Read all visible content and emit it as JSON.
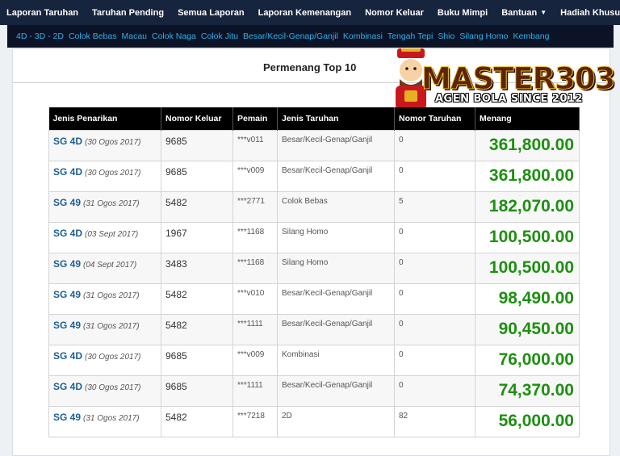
{
  "top_nav": [
    {
      "label": "Laporan Taruhan"
    },
    {
      "label": "Taruhan Pending"
    },
    {
      "label": "Semua Laporan"
    },
    {
      "label": "Laporan Kemenangan"
    },
    {
      "label": "Nomor Keluar"
    },
    {
      "label": "Buku Mimpi"
    },
    {
      "label": "Bantuan"
    },
    {
      "label": "Hadiah Khusus"
    }
  ],
  "sub_nav": [
    "4D - 3D - 2D",
    "Colok Bebas",
    "Macau",
    "Colok Naga",
    "Colok Jitu",
    "Besar/Kecil-Genap/Ganjil",
    "Kombinasi",
    "Tengah Tepi",
    "Shio",
    "Silang Homo",
    "Kembang"
  ],
  "panel": {
    "title": "Permenang Top 10"
  },
  "logo": {
    "wordmark": "MASTER303",
    "tagline": "AGEN BOLA SINCE 2012"
  },
  "colors": {
    "nav_bg": "#17243d",
    "subnav_bg": "#0d1326",
    "subnav_link": "#29b3ee",
    "amount": "#1e8f12",
    "pasaran": "#1d5f95"
  },
  "table": {
    "headers": [
      "Jenis Penarikan",
      "Nomor Keluar",
      "Pemain",
      "Jenis Taruhan",
      "Nomor Taruhan",
      "Menang"
    ],
    "rows": [
      {
        "pasaran": "SG 4D",
        "tanggal": "(30 Ogos 2017)",
        "nomor_keluar": "9685",
        "pemain": "***v011",
        "jenis_taruhan": "Besar/Kecil-Genap/Ganjil",
        "nomor_taruhan": "0",
        "menang": "361,800.00"
      },
      {
        "pasaran": "SG 4D",
        "tanggal": "(30 Ogos 2017)",
        "nomor_keluar": "9685",
        "pemain": "***v009",
        "jenis_taruhan": "Besar/Kecil-Genap/Ganjil",
        "nomor_taruhan": "0",
        "menang": "361,800.00"
      },
      {
        "pasaran": "SG 49",
        "tanggal": "(31 Ogos 2017)",
        "nomor_keluar": "5482",
        "pemain": "***2771",
        "jenis_taruhan": "Colok Bebas",
        "nomor_taruhan": "5",
        "menang": "182,070.00"
      },
      {
        "pasaran": "SG 4D",
        "tanggal": "(03 Sept 2017)",
        "nomor_keluar": "1967",
        "pemain": "***1168",
        "jenis_taruhan": "Silang Homo",
        "nomor_taruhan": "0",
        "menang": "100,500.00"
      },
      {
        "pasaran": "SG 49",
        "tanggal": "(04 Sept 2017)",
        "nomor_keluar": "3483",
        "pemain": "***1168",
        "jenis_taruhan": "Silang Homo",
        "nomor_taruhan": "0",
        "menang": "100,500.00"
      },
      {
        "pasaran": "SG 49",
        "tanggal": "(31 Ogos 2017)",
        "nomor_keluar": "5482",
        "pemain": "***v010",
        "jenis_taruhan": "Besar/Kecil-Genap/Ganjil",
        "nomor_taruhan": "0",
        "menang": "98,490.00"
      },
      {
        "pasaran": "SG 49",
        "tanggal": "(31 Ogos 2017)",
        "nomor_keluar": "5482",
        "pemain": "***1111",
        "jenis_taruhan": "Besar/Kecil-Genap/Ganjil",
        "nomor_taruhan": "0",
        "menang": "90,450.00"
      },
      {
        "pasaran": "SG 4D",
        "tanggal": "(30 Ogos 2017)",
        "nomor_keluar": "9685",
        "pemain": "***v009",
        "jenis_taruhan": "Kombinasi",
        "nomor_taruhan": "0",
        "menang": "76,000.00"
      },
      {
        "pasaran": "SG 4D",
        "tanggal": "(30 Ogos 2017)",
        "nomor_keluar": "9685",
        "pemain": "***1111",
        "jenis_taruhan": "Besar/Kecil-Genap/Ganjil",
        "nomor_taruhan": "0",
        "menang": "74,370.00"
      },
      {
        "pasaran": "SG 49",
        "tanggal": "(31 Ogos 2017)",
        "nomor_keluar": "5482",
        "pemain": "***7218",
        "jenis_taruhan": "2D",
        "nomor_taruhan": "82",
        "menang": "56,000.00"
      }
    ]
  }
}
